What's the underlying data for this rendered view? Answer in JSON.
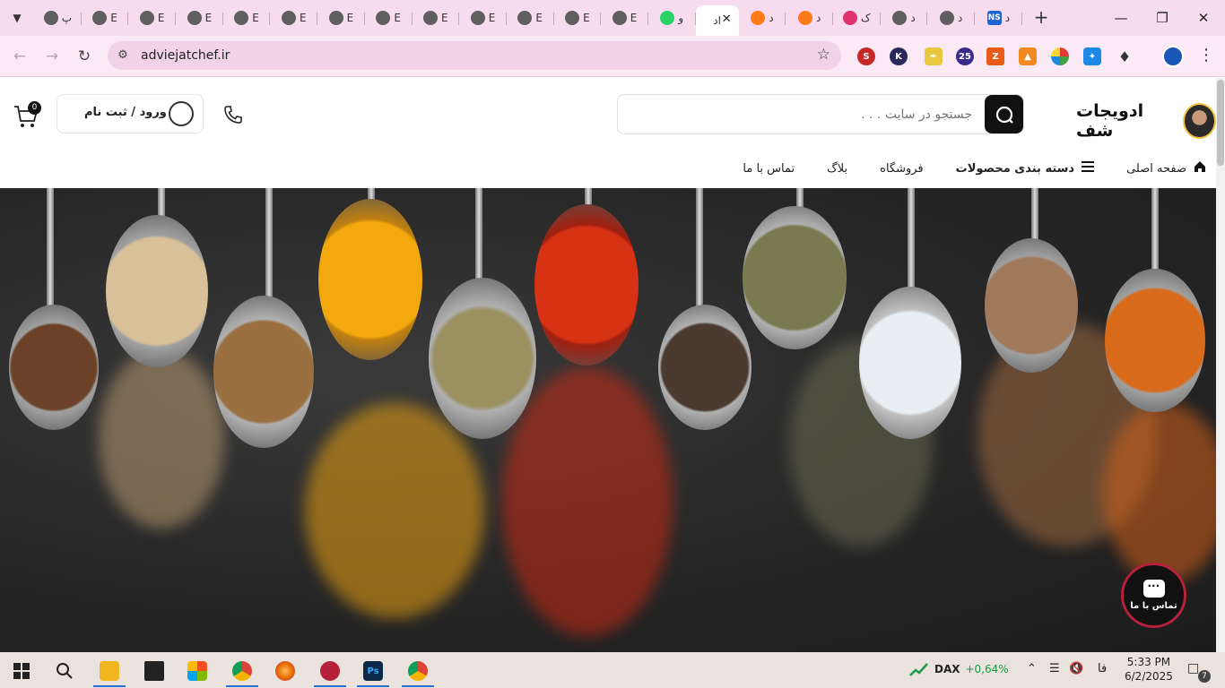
{
  "browser": {
    "tabs": [
      {
        "label": "پ",
        "favicon": "grey"
      },
      {
        "label": "E",
        "favicon": "grey"
      },
      {
        "label": "E",
        "favicon": "grey"
      },
      {
        "label": "E",
        "favicon": "grey"
      },
      {
        "label": "E",
        "favicon": "grey"
      },
      {
        "label": "E",
        "favicon": "grey"
      },
      {
        "label": "E",
        "favicon": "grey"
      },
      {
        "label": "E",
        "favicon": "grey"
      },
      {
        "label": "E",
        "favicon": "grey"
      },
      {
        "label": "E",
        "favicon": "grey"
      },
      {
        "label": "E",
        "favicon": "grey"
      },
      {
        "label": "E",
        "favicon": "grey"
      },
      {
        "label": "E",
        "favicon": "grey"
      },
      {
        "label": "و",
        "favicon": "wa"
      },
      {
        "label": "اد",
        "favicon": "none",
        "active": true
      },
      {
        "label": "د",
        "favicon": "orange"
      },
      {
        "label": "د",
        "favicon": "orange"
      },
      {
        "label": "ک",
        "favicon": "pink"
      },
      {
        "label": "د",
        "favicon": "grey"
      },
      {
        "label": "د",
        "favicon": "grey"
      },
      {
        "label": "د",
        "favicon": "ns"
      }
    ],
    "new_tab_symbol": "+",
    "url": "adviejatchef.ir"
  },
  "site": {
    "logo_text": "ادویجات شف",
    "search_placeholder": "جستجو در سایت . . .",
    "login_label": "ورود / ثبت نام",
    "cart_count": "0",
    "nav": [
      {
        "label": "صفحه اصلی",
        "icon": "home-icon",
        "bold": false
      },
      {
        "label": "دسته بندی محصولات",
        "icon": "menu-icon",
        "bold": true
      },
      {
        "label": "فروشگاه",
        "icon": "",
        "bold": false
      },
      {
        "label": "بلاگ",
        "icon": "",
        "bold": false
      },
      {
        "label": "تماس با ما",
        "icon": "",
        "bold": false
      }
    ],
    "contact_fab_label": "تماس با ما"
  },
  "taskbar": {
    "ticker_label": "DAX",
    "ticker_value": "+0,64%",
    "language": "فا",
    "time": "5:33 PM",
    "date": "6/2/2025",
    "notification_count": "7"
  },
  "colors": {
    "tabstrip": "#f7dcef",
    "accent_dark": "#111111",
    "fab_ring": "#b5203a",
    "ticker_green": "#1a9a4a"
  }
}
